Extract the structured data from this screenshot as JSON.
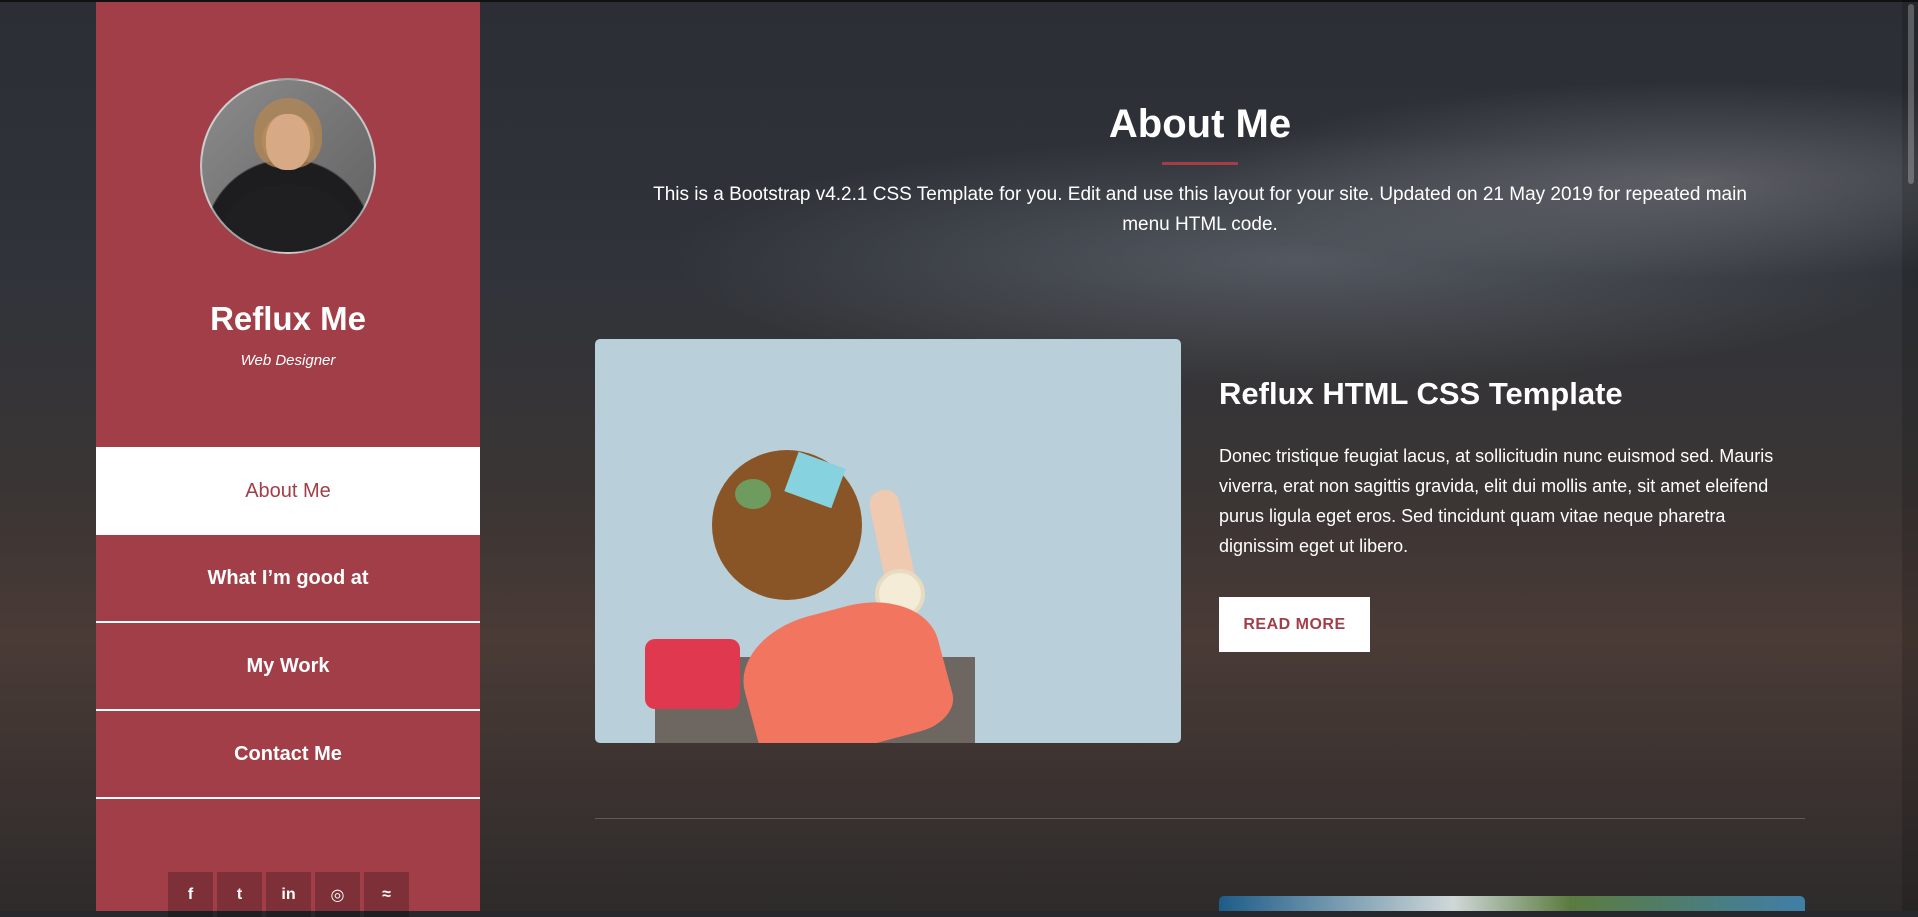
{
  "sidebar": {
    "name": "Reflux Me",
    "role": "Web Designer",
    "nav": [
      {
        "label": "About Me"
      },
      {
        "label": "What I’m good at"
      },
      {
        "label": "My Work"
      },
      {
        "label": "Contact Me"
      }
    ],
    "social": [
      {
        "icon": "facebook-icon",
        "glyph": "f"
      },
      {
        "icon": "twitter-icon",
        "glyph": "t"
      },
      {
        "icon": "linkedin-icon",
        "glyph": "in"
      },
      {
        "icon": "dribbble-icon",
        "glyph": "◎"
      },
      {
        "icon": "rss-icon",
        "glyph": "≈"
      }
    ]
  },
  "main": {
    "title": "About Me",
    "intro": "This is a Bootstrap v4.2.1 CSS Template for you. Edit and use this layout for your site. Updated on 21 May 2019 for repeated main menu HTML code.",
    "card": {
      "title": "Reflux HTML CSS Template",
      "text": "Donec tristique feugiat lacus, at sollicitudin nunc euismod sed. Mauris viverra, erat non sagittis gravida, elit dui mollis ante, sit amet eleifend purus ligula eget eros. Sed tincidunt quam vitae neque pharetra dignissim eget ut libero.",
      "button": "READ MORE"
    }
  },
  "colors": {
    "accent": "#a23e48"
  }
}
